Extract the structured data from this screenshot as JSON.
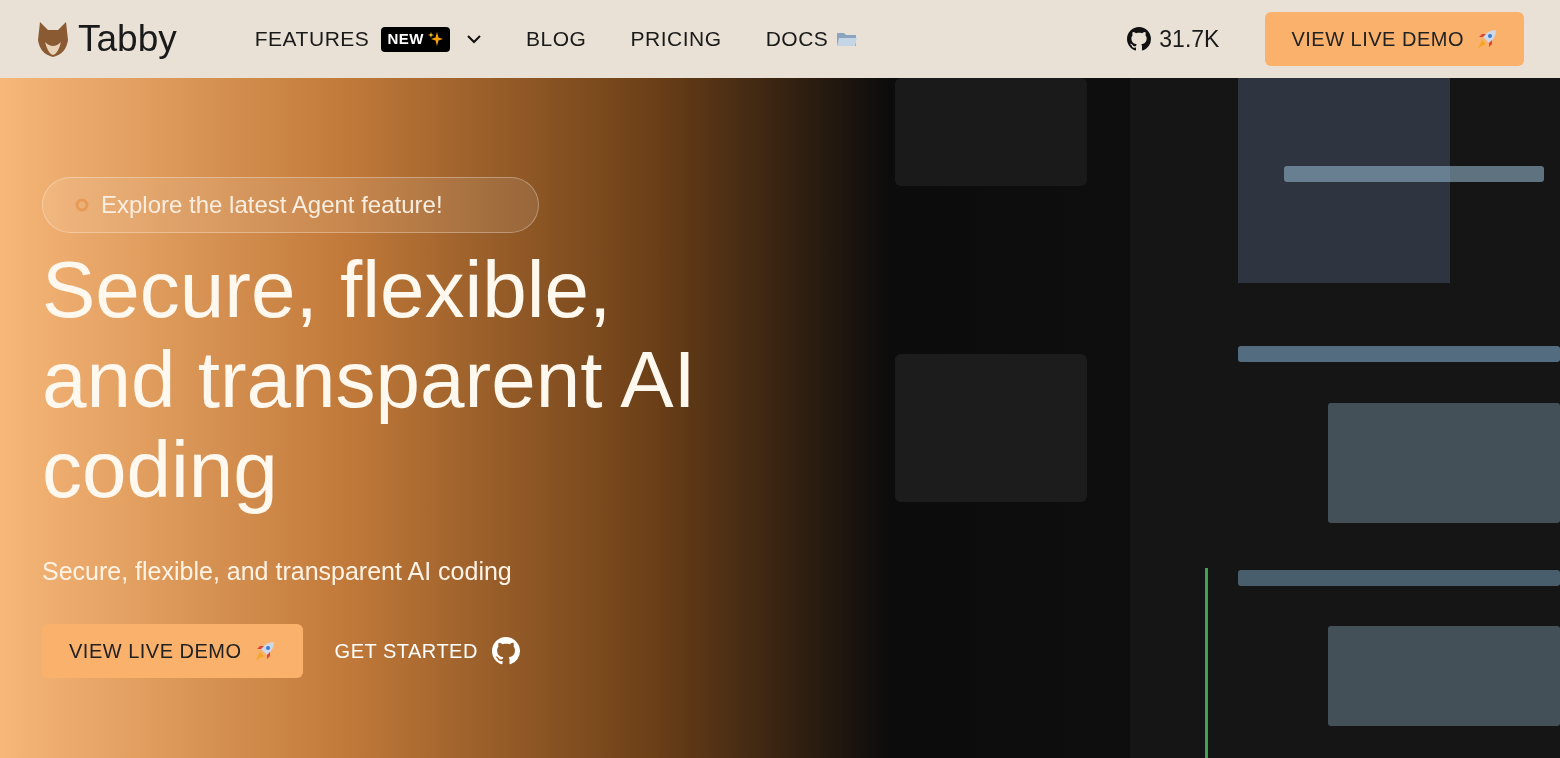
{
  "nav": {
    "logo": "Tabby",
    "links": [
      {
        "label": "FEATURES",
        "badge": "NEW",
        "dropdown": true
      },
      {
        "label": "BLOG",
        "dropdown": false
      },
      {
        "label": "PRICING",
        "dropdown": false
      },
      {
        "label": "DOCS",
        "dropdown": false
      }
    ],
    "github_stars": "31.7K",
    "cta": "VIEW LIVE DEMO"
  },
  "hero": {
    "announcement": "Explore the latest Agent feature!",
    "heading": "Secure, flexible, and transparent AI coding",
    "subtitle": "Secure, flexible, and transparent AI coding",
    "buttons": [
      {
        "label": "VIEW LIVE DEMO",
        "kind": "primary"
      },
      {
        "label": "GET STARTED",
        "kind": "secondary"
      }
    ]
  }
}
